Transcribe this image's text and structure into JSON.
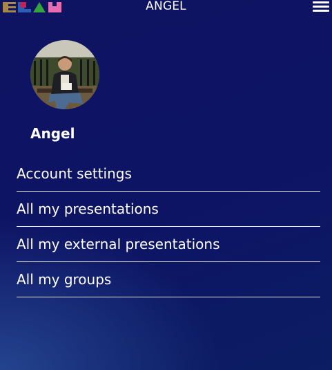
{
  "header": {
    "logo_icon": "elam-logo-icon",
    "title": "ANGEL",
    "menu_icon": "hamburger-menu-icon"
  },
  "profile": {
    "avatar_icon": "user-photo-avatar",
    "name": "Angel"
  },
  "menu": {
    "items": [
      {
        "label": "Account settings"
      },
      {
        "label": "All my presentations"
      },
      {
        "label": "All my external presentations"
      },
      {
        "label": "All my groups"
      }
    ]
  },
  "colors": {
    "background": "#0f1462",
    "text": "#ffffff",
    "divider": "#ffffff"
  }
}
